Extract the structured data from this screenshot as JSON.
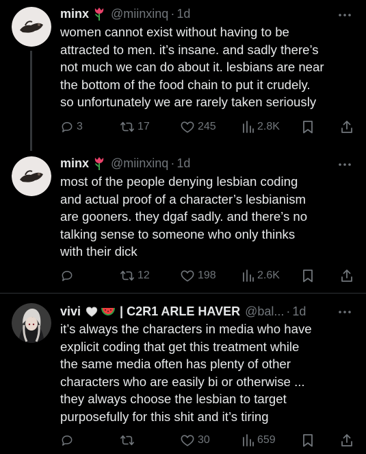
{
  "tweets": [
    {
      "display_name": "minx",
      "emoji": "tulip",
      "handle": "@miinxinq",
      "time": "1d",
      "lines": [
        "women cannot exist without having to be",
        "attracted to men. it’s insane. and sadly there’s",
        "not much we can do about it. lesbians are near",
        "the bottom of the food chain to put it crudely.",
        "so unfortunately we are rarely taken seriously"
      ],
      "replies": "3",
      "reposts": "17",
      "likes": "245",
      "views": "2.8K"
    },
    {
      "display_name": "minx",
      "emoji": "tulip",
      "handle": "@miinxinq",
      "time": "1d",
      "lines": [
        "most of the people denying lesbian coding",
        "and actual proof of a character’s lesbianism",
        "are gooners. they dgaf sadly. and there’s no",
        "talking sense to someone who only thinks",
        "with their dick"
      ],
      "replies": "",
      "reposts": "12",
      "likes": "198",
      "views": "2.6K"
    },
    {
      "display_name": "vivi",
      "emoji": "white-heart watermelon",
      "name_suffix": "| C2R1 ARLE HAVER",
      "handle": "@bal...",
      "time": "1d",
      "lines": [
        "it’s always the characters in media who have",
        "explicit coding that get this treatment while",
        "the same media often has plenty of other",
        "characters who are easily bi or otherwise ...",
        "they always choose the lesbian to target",
        "purposefully for this shit and it’s tiring"
      ],
      "replies": "",
      "reposts": "",
      "likes": "30",
      "views": "659"
    }
  ],
  "colors": {
    "background": "#000000",
    "text": "#e7e9ea",
    "secondary": "#71767b",
    "divider": "#2f3336"
  }
}
